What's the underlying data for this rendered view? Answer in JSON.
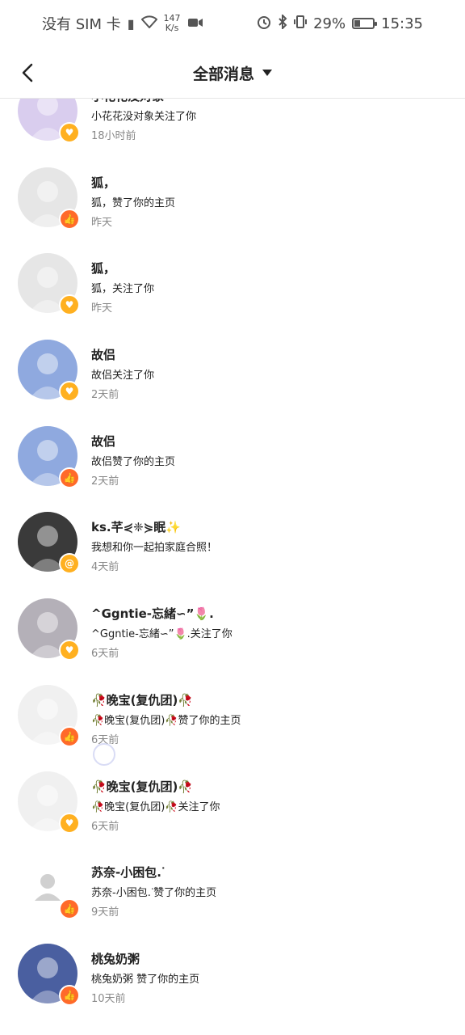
{
  "status_bar": {
    "carrier": "没有 SIM 卡",
    "net_speed_value": "147",
    "net_speed_unit": "K/s",
    "battery": "29%",
    "time": "15:35"
  },
  "header": {
    "title": "全部消息"
  },
  "colors": {
    "follow_badge": "#ffb020",
    "like_badge": "#ff6a2a",
    "muted_text": "#888888"
  },
  "messages": [
    {
      "name": "小花花没对象",
      "msg": "小花花没对象关注了你",
      "time": "18小时前",
      "type": "follow",
      "avatar_color": "#d9cdee",
      "icon": "heart-icon"
    },
    {
      "name": "狐，",
      "msg": "狐，赞了你的主页",
      "time": "昨天",
      "type": "like",
      "avatar_color": "#e6e6e6",
      "icon": "thumbs-up-icon"
    },
    {
      "name": "狐，",
      "msg": "狐，关注了你",
      "time": "昨天",
      "type": "follow",
      "avatar_color": "#e6e6e6",
      "icon": "heart-icon"
    },
    {
      "name": "故侣",
      "msg": "故侣关注了你",
      "time": "2天前",
      "type": "follow",
      "avatar_color": "#8fa9df",
      "icon": "heart-icon"
    },
    {
      "name": "故侣",
      "msg": "故侣赞了你的主页",
      "time": "2天前",
      "type": "like",
      "avatar_color": "#8fa9df",
      "icon": "thumbs-up-icon"
    },
    {
      "name": "ks.芊⋞❈⋟眠✨",
      "msg": "我想和你一起拍家庭合照！",
      "time": "4天前",
      "type": "at",
      "avatar_color": "#3a3a3a",
      "icon": "at-icon"
    },
    {
      "name": "^Ggntie-忘緒∽”🌷.",
      "msg": "^Ggntie-忘緒∽”🌷.关注了你",
      "time": "6天前",
      "type": "follow",
      "avatar_color": "#b4b0b8",
      "icon": "heart-icon"
    },
    {
      "name": "🥀晚宝(复仇团)🥀",
      "msg": "🥀晚宝(复仇团)🥀赞了你的主页",
      "time": "6天前",
      "type": "like",
      "avatar_color": "#f0f0f0",
      "icon": "thumbs-up-icon"
    },
    {
      "name": "🥀晚宝(复仇团)🥀",
      "msg": "🥀晚宝(复仇团)🥀关注了你",
      "time": "6天前",
      "type": "follow",
      "avatar_color": "#f0f0f0",
      "icon": "heart-icon"
    },
    {
      "name": "苏奈-小困包.ᐝ",
      "msg": "苏奈-小困包.ᐝ赞了你的主页",
      "time": "9天前",
      "type": "like",
      "avatar_color": "#ffffff",
      "icon": "thumbs-up-icon"
    },
    {
      "name": "桃兔奶粥",
      "msg": "桃兔奶粥 赞了你的主页",
      "time": "10天前",
      "type": "like",
      "avatar_color": "#4a5fa0",
      "icon": "thumbs-up-icon"
    }
  ]
}
